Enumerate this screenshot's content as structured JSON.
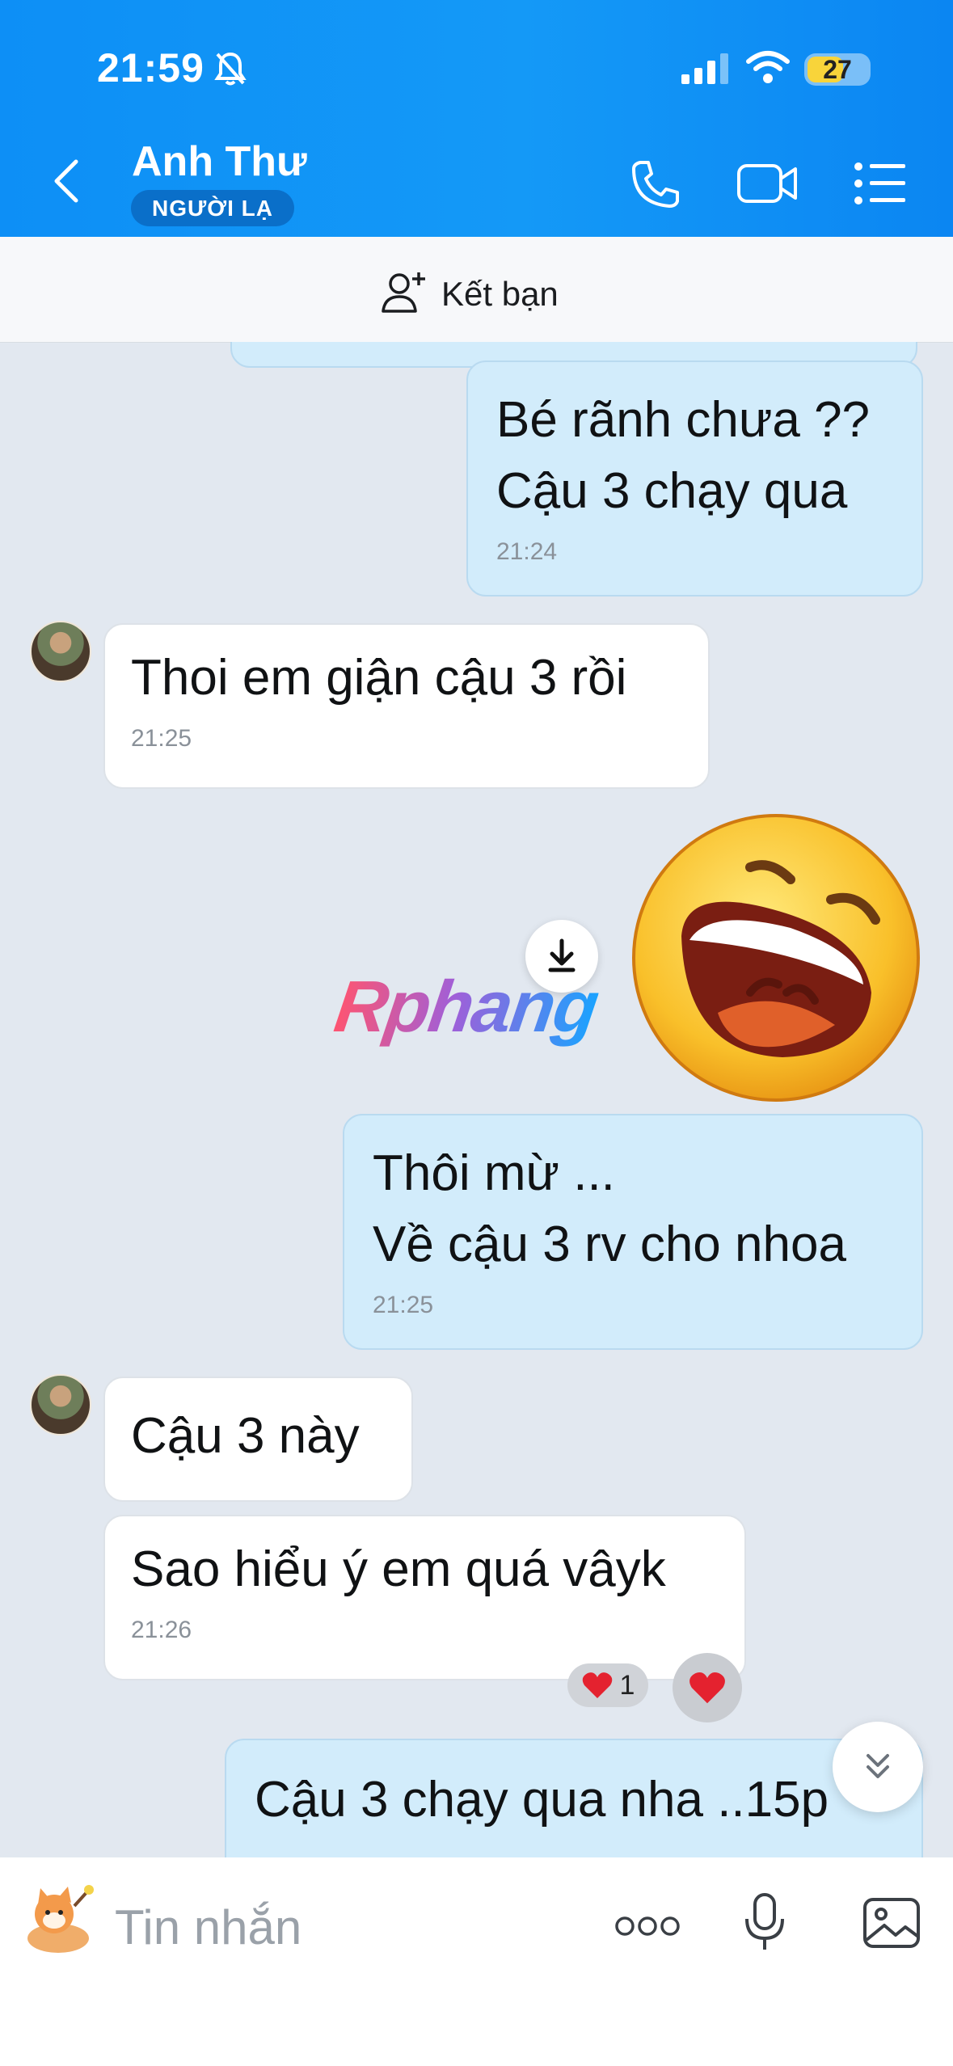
{
  "status_bar": {
    "time": "21:59",
    "battery": "27",
    "icons": [
      "bell-slash-icon",
      "signal-icon",
      "wifi-icon",
      "battery-icon"
    ]
  },
  "header": {
    "contact_name": "Anh Thư",
    "badge": "NGƯỜI LẠ",
    "icons": [
      "back-icon",
      "phone-icon",
      "video-icon",
      "menu-list-icon"
    ],
    "colors": {
      "bar": "#0d8ff6",
      "badge": "#0a6fc9"
    }
  },
  "add_friend": {
    "label": "Kết bạn",
    "icon": "add-user-icon"
  },
  "messages": [
    {
      "direction": "out",
      "text": "Bé rãnh chưa ??\nCậu 3 chạy qua",
      "time": "21:24"
    },
    {
      "direction": "in",
      "text": "Thoi em giận cậu 3 rồi",
      "time": "21:25"
    },
    {
      "direction": "out",
      "type": "sticker",
      "sticker": "laughing-emoji-sticker"
    },
    {
      "direction": "out",
      "text": "Thôi mừ ...\nVề cậu 3 rv cho nhoa",
      "time": "21:25"
    },
    {
      "direction": "in",
      "text": "Cậu 3 này"
    },
    {
      "direction": "in",
      "text": "Sao hiểu ý em quá vâyk",
      "time": "21:26",
      "reaction": {
        "emoji": "heart",
        "count": "1"
      }
    },
    {
      "direction": "out",
      "text": "Cậu 3 chạy qua nha ..15p"
    }
  ],
  "watermark": "Rphang",
  "input": {
    "placeholder": "Tin nhắn",
    "icons": [
      "sticker-icon",
      "more-icon",
      "microphone-icon",
      "image-icon"
    ]
  },
  "colors": {
    "chat_bg": "#e2e8f0",
    "outgoing_bubble": "#d2ecfb",
    "incoming_bubble": "#ffffff"
  }
}
